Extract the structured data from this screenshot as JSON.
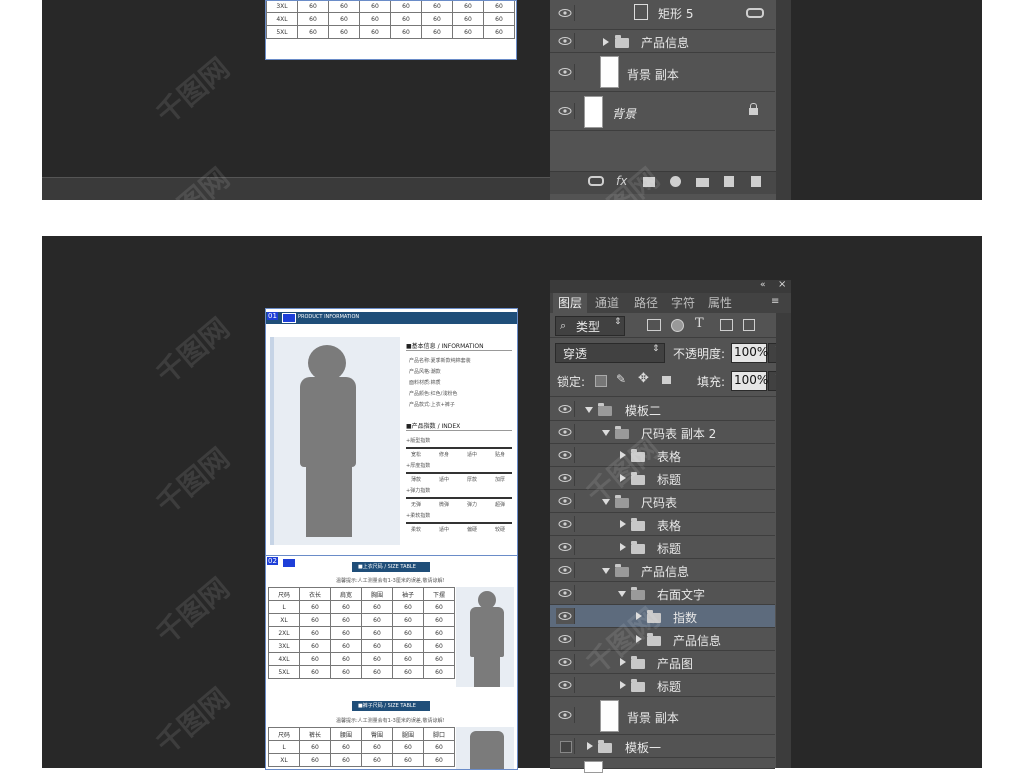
{
  "top": {
    "table_rows": [
      {
        "size": "3XL",
        "vals": [
          "60",
          "60",
          "60",
          "60",
          "60",
          "60",
          "60"
        ]
      },
      {
        "size": "4XL",
        "vals": [
          "60",
          "60",
          "60",
          "60",
          "60",
          "60",
          "60"
        ]
      },
      {
        "size": "5XL",
        "vals": [
          "60",
          "60",
          "60",
          "60",
          "60",
          "60",
          "60"
        ]
      }
    ],
    "layers": [
      {
        "label": "矩形 5",
        "type": "shape"
      },
      {
        "label": "产品信息",
        "type": "folder"
      },
      {
        "label": "背景 副本",
        "type": "thumb"
      },
      {
        "label": "背景",
        "type": "thumb"
      }
    ]
  },
  "panel": {
    "tabs": [
      "图层",
      "通道",
      "路径",
      "字符",
      "属性"
    ],
    "filter_label": "类型",
    "blend_mode": "穿透",
    "opacity_label": "不透明度:",
    "opacity_value": "100%",
    "lock_label": "锁定:",
    "fill_label": "填充:",
    "fill_value": "100%",
    "layers": [
      {
        "label": "模板二"
      },
      {
        "label": "尺码表 副本 2"
      },
      {
        "label": "表格"
      },
      {
        "label": "标题"
      },
      {
        "label": "尺码表"
      },
      {
        "label": "表格"
      },
      {
        "label": "标题"
      },
      {
        "label": "产品信息"
      },
      {
        "label": "右面文字"
      },
      {
        "label": "指数"
      },
      {
        "label": "产品信息"
      },
      {
        "label": "产品图"
      },
      {
        "label": "标题"
      },
      {
        "label": "背景 副本"
      },
      {
        "label": "模板一"
      }
    ]
  },
  "doc": {
    "badge1": "01",
    "badge2": "02",
    "product_info_heading": "PRODUCT INFORMATION",
    "basic_info_heading": "■基本信息 / INFORMATION",
    "info_lines": [
      "产品名称:夏季新款纯棉套装",
      "产品风格:潮款",
      "面料材质:棉质",
      "产品颜色:红色/浅粉色",
      "产品款式:上衣+裤子"
    ],
    "index_heading": "■产品指数 / INDEX",
    "indices": [
      {
        "name": "+版型指数",
        "ticks": [
          "宽松",
          "修身",
          "适中",
          "贴身"
        ]
      },
      {
        "name": "+厚度指数",
        "ticks": [
          "薄款",
          "适中",
          "厚款",
          "加厚"
        ]
      },
      {
        "name": "+弹力指数",
        "ticks": [
          "无弹",
          "微弹",
          "弹力",
          "超弹"
        ]
      },
      {
        "name": "+柔软指数",
        "ticks": [
          "柔软",
          "适中",
          "偏硬",
          "较硬"
        ]
      }
    ],
    "top_size_title": "■上衣尺码 / SIZE TABLE",
    "tip": "温馨提示:人工测量会有1-3厘米的误差,敬请谅解!",
    "top_headers": [
      "尺码",
      "衣长",
      "肩宽",
      "胸围",
      "袖子",
      "下摆"
    ],
    "top_rows": [
      [
        "L",
        "60",
        "60",
        "60",
        "60",
        "60"
      ],
      [
        "XL",
        "60",
        "60",
        "60",
        "60",
        "60"
      ],
      [
        "2XL",
        "60",
        "60",
        "60",
        "60",
        "60"
      ],
      [
        "3XL",
        "60",
        "60",
        "60",
        "60",
        "60"
      ],
      [
        "4XL",
        "60",
        "60",
        "60",
        "60",
        "60"
      ],
      [
        "5XL",
        "60",
        "60",
        "60",
        "60",
        "60"
      ]
    ],
    "pants_size_title": "■裤子尺码 / SIZE TABLE",
    "pants_headers": [
      "尺码",
      "裤长",
      "腰围",
      "臀围",
      "腿围",
      "脚口"
    ],
    "pants_rows": [
      [
        "L",
        "60",
        "60",
        "60",
        "60",
        "60"
      ],
      [
        "XL",
        "60",
        "60",
        "60",
        "60",
        "60"
      ]
    ]
  },
  "watermark": "千图网"
}
